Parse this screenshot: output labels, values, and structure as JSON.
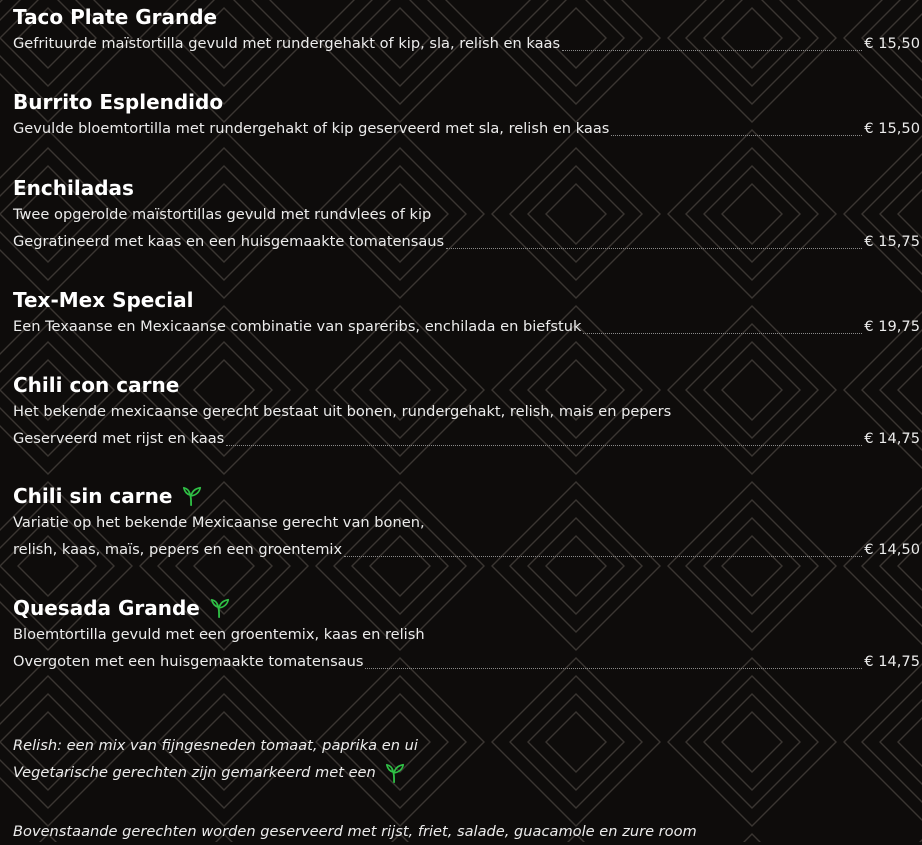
{
  "colors": {
    "background": "#0e0c0b",
    "pattern": "#3a3632",
    "veg_icon": "#2fbf45",
    "text": "#f2f2f2"
  },
  "items": [
    {
      "title": "Taco Plate Grande",
      "veg": false,
      "lines": [],
      "last_line": "Gefrituurde maïstortilla gevuld met rundergehakt of kip, sla, relish en kaas",
      "price": "€ 15,50"
    },
    {
      "title": "Burrito Esplendido",
      "veg": false,
      "lines": [],
      "last_line": "Gevulde bloemtortilla met rundergehakt of kip geserveerd met sla, relish en kaas",
      "price": "€ 15,50"
    },
    {
      "title": "Enchiladas",
      "veg": false,
      "lines": [
        "Twee opgerolde maïstortillas gevuld met rundvlees of kip"
      ],
      "last_line": "Gegratineerd met kaas en een huisgemaakte tomatensaus",
      "price": "€ 15,75"
    },
    {
      "title": "Tex-Mex Special",
      "veg": false,
      "lines": [],
      "last_line": "Een Texaanse en Mexicaanse combinatie van spareribs, enchilada en biefstuk",
      "price": "€ 19,75"
    },
    {
      "title": "Chili con carne",
      "veg": false,
      "lines": [
        "Het bekende mexicaanse gerecht bestaat uit bonen, rundergehakt, relish, mais en pepers"
      ],
      "last_line": "Geserveerd met rijst en kaas",
      "price": "€ 14,75"
    },
    {
      "title": "Chili sin carne",
      "veg": true,
      "lines": [
        "Variatie op het bekende Mexicaanse gerecht van bonen,"
      ],
      "last_line": "relish, kaas, maïs, pepers en een groentemix",
      "price": "€ 14,50"
    },
    {
      "title": "Quesada Grande",
      "veg": true,
      "lines": [
        "Bloemtortilla gevuld met een groentemix, kaas en relish"
      ],
      "last_line": "Overgoten met een huisgemaakte tomatensaus",
      "price": "€ 14,75"
    }
  ],
  "notes": {
    "relish": "Relish: een mix van fijngesneden tomaat, paprika en ui",
    "vegetarian": "Vegetarische gerechten zijn gemarkeerd met een",
    "served_with": "Bovenstaande gerechten worden geserveerd met rijst, friet, salade, guacamole en zure room"
  },
  "icons": {
    "veg": "sprout-icon"
  }
}
